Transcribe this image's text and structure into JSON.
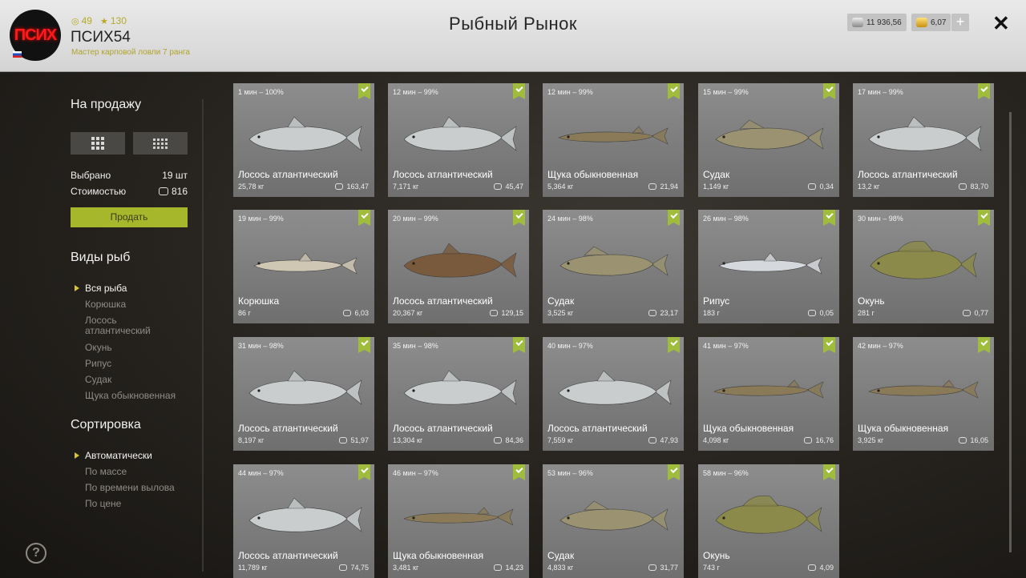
{
  "header": {
    "title": "Рыбный Рынок",
    "avatar_text": "ПСИХ",
    "username": "ПСИХ54",
    "rank": "Мастер карповой ловли 7 ранга",
    "level": "49",
    "stars": "130",
    "silver": "11 936,56",
    "gold": "6,07",
    "plus": "+",
    "close": "✕"
  },
  "sidebar": {
    "for_sale_title": "На продажу",
    "selected_label": "Выбрано",
    "selected_value": "19 шт",
    "cost_label": "Стоимостью",
    "cost_value": "816",
    "sell_button": "Продать",
    "fish_types_title": "Виды рыб",
    "fish_types": [
      "Вся рыба",
      "Корюшка",
      "Лосось атлантический",
      "Окунь",
      "Рипус",
      "Судак",
      "Щука обыкновенная"
    ],
    "sort_title": "Сортировка",
    "sort_options": [
      "Автоматически",
      "По массе",
      "По времени вылова",
      "По цене"
    ],
    "help": "?"
  },
  "fish_colors": {
    "salmon": "#c9cdcd",
    "pike": "#8a7a58",
    "zander": "#9a9270",
    "smelt": "#cfc6b4",
    "brown_salmon": "#7a5a3c",
    "ripus": "#d5d8dc",
    "perch": "#8c8a4a"
  },
  "cards": [
    {
      "time": "1 мин – 100%",
      "name": "Лосось атлантический",
      "weight": "25,78 кг",
      "price": "163,47",
      "fish": "salmon"
    },
    {
      "time": "12 мин – 99%",
      "name": "Лосось атлантический",
      "weight": "7,171 кг",
      "price": "45,47",
      "fish": "salmon"
    },
    {
      "time": "12 мин – 99%",
      "name": "Щука обыкновенная",
      "weight": "5,364 кг",
      "price": "21,94",
      "fish": "pike"
    },
    {
      "time": "15 мин – 99%",
      "name": "Судак",
      "weight": "1,149 кг",
      "price": "0,34",
      "fish": "zander"
    },
    {
      "time": "17 мин – 99%",
      "name": "Лосось атлантический",
      "weight": "13,2 кг",
      "price": "83,70",
      "fish": "salmon"
    },
    {
      "time": "19 мин – 99%",
      "name": "Корюшка",
      "weight": "86 г",
      "price": "6,03",
      "fish": "smelt"
    },
    {
      "time": "20 мин – 99%",
      "name": "Лосось атлантический",
      "weight": "20,367 кг",
      "price": "129,15",
      "fish": "brown_salmon"
    },
    {
      "time": "24 мин – 98%",
      "name": "Судак",
      "weight": "3,525 кг",
      "price": "23,17",
      "fish": "zander"
    },
    {
      "time": "26 мин – 98%",
      "name": "Рипус",
      "weight": "183 г",
      "price": "0,05",
      "fish": "ripus"
    },
    {
      "time": "30 мин – 98%",
      "name": "Окунь",
      "weight": "281 г",
      "price": "0,77",
      "fish": "perch"
    },
    {
      "time": "31 мин – 98%",
      "name": "Лосось атлантический",
      "weight": "8,197 кг",
      "price": "51,97",
      "fish": "salmon"
    },
    {
      "time": "35 мин – 98%",
      "name": "Лосось атлантический",
      "weight": "13,304 кг",
      "price": "84,36",
      "fish": "salmon"
    },
    {
      "time": "40 мин – 97%",
      "name": "Лосось атлантический",
      "weight": "7,559 кг",
      "price": "47,93",
      "fish": "salmon"
    },
    {
      "time": "41 мин – 97%",
      "name": "Щука обыкновенная",
      "weight": "4,098 кг",
      "price": "16,76",
      "fish": "pike"
    },
    {
      "time": "42 мин – 97%",
      "name": "Щука обыкновенная",
      "weight": "3,925 кг",
      "price": "16,05",
      "fish": "pike"
    },
    {
      "time": "44 мин – 97%",
      "name": "Лосось атлантический",
      "weight": "11,789 кг",
      "price": "74,75",
      "fish": "salmon"
    },
    {
      "time": "46 мин – 97%",
      "name": "Щука обыкновенная",
      "weight": "3,481 кг",
      "price": "14,23",
      "fish": "pike"
    },
    {
      "time": "53 мин – 96%",
      "name": "Судак",
      "weight": "4,833 кг",
      "price": "31,77",
      "fish": "zander"
    },
    {
      "time": "58 мин – 96%",
      "name": "Окунь",
      "weight": "743 г",
      "price": "4,09",
      "fish": "perch"
    }
  ]
}
